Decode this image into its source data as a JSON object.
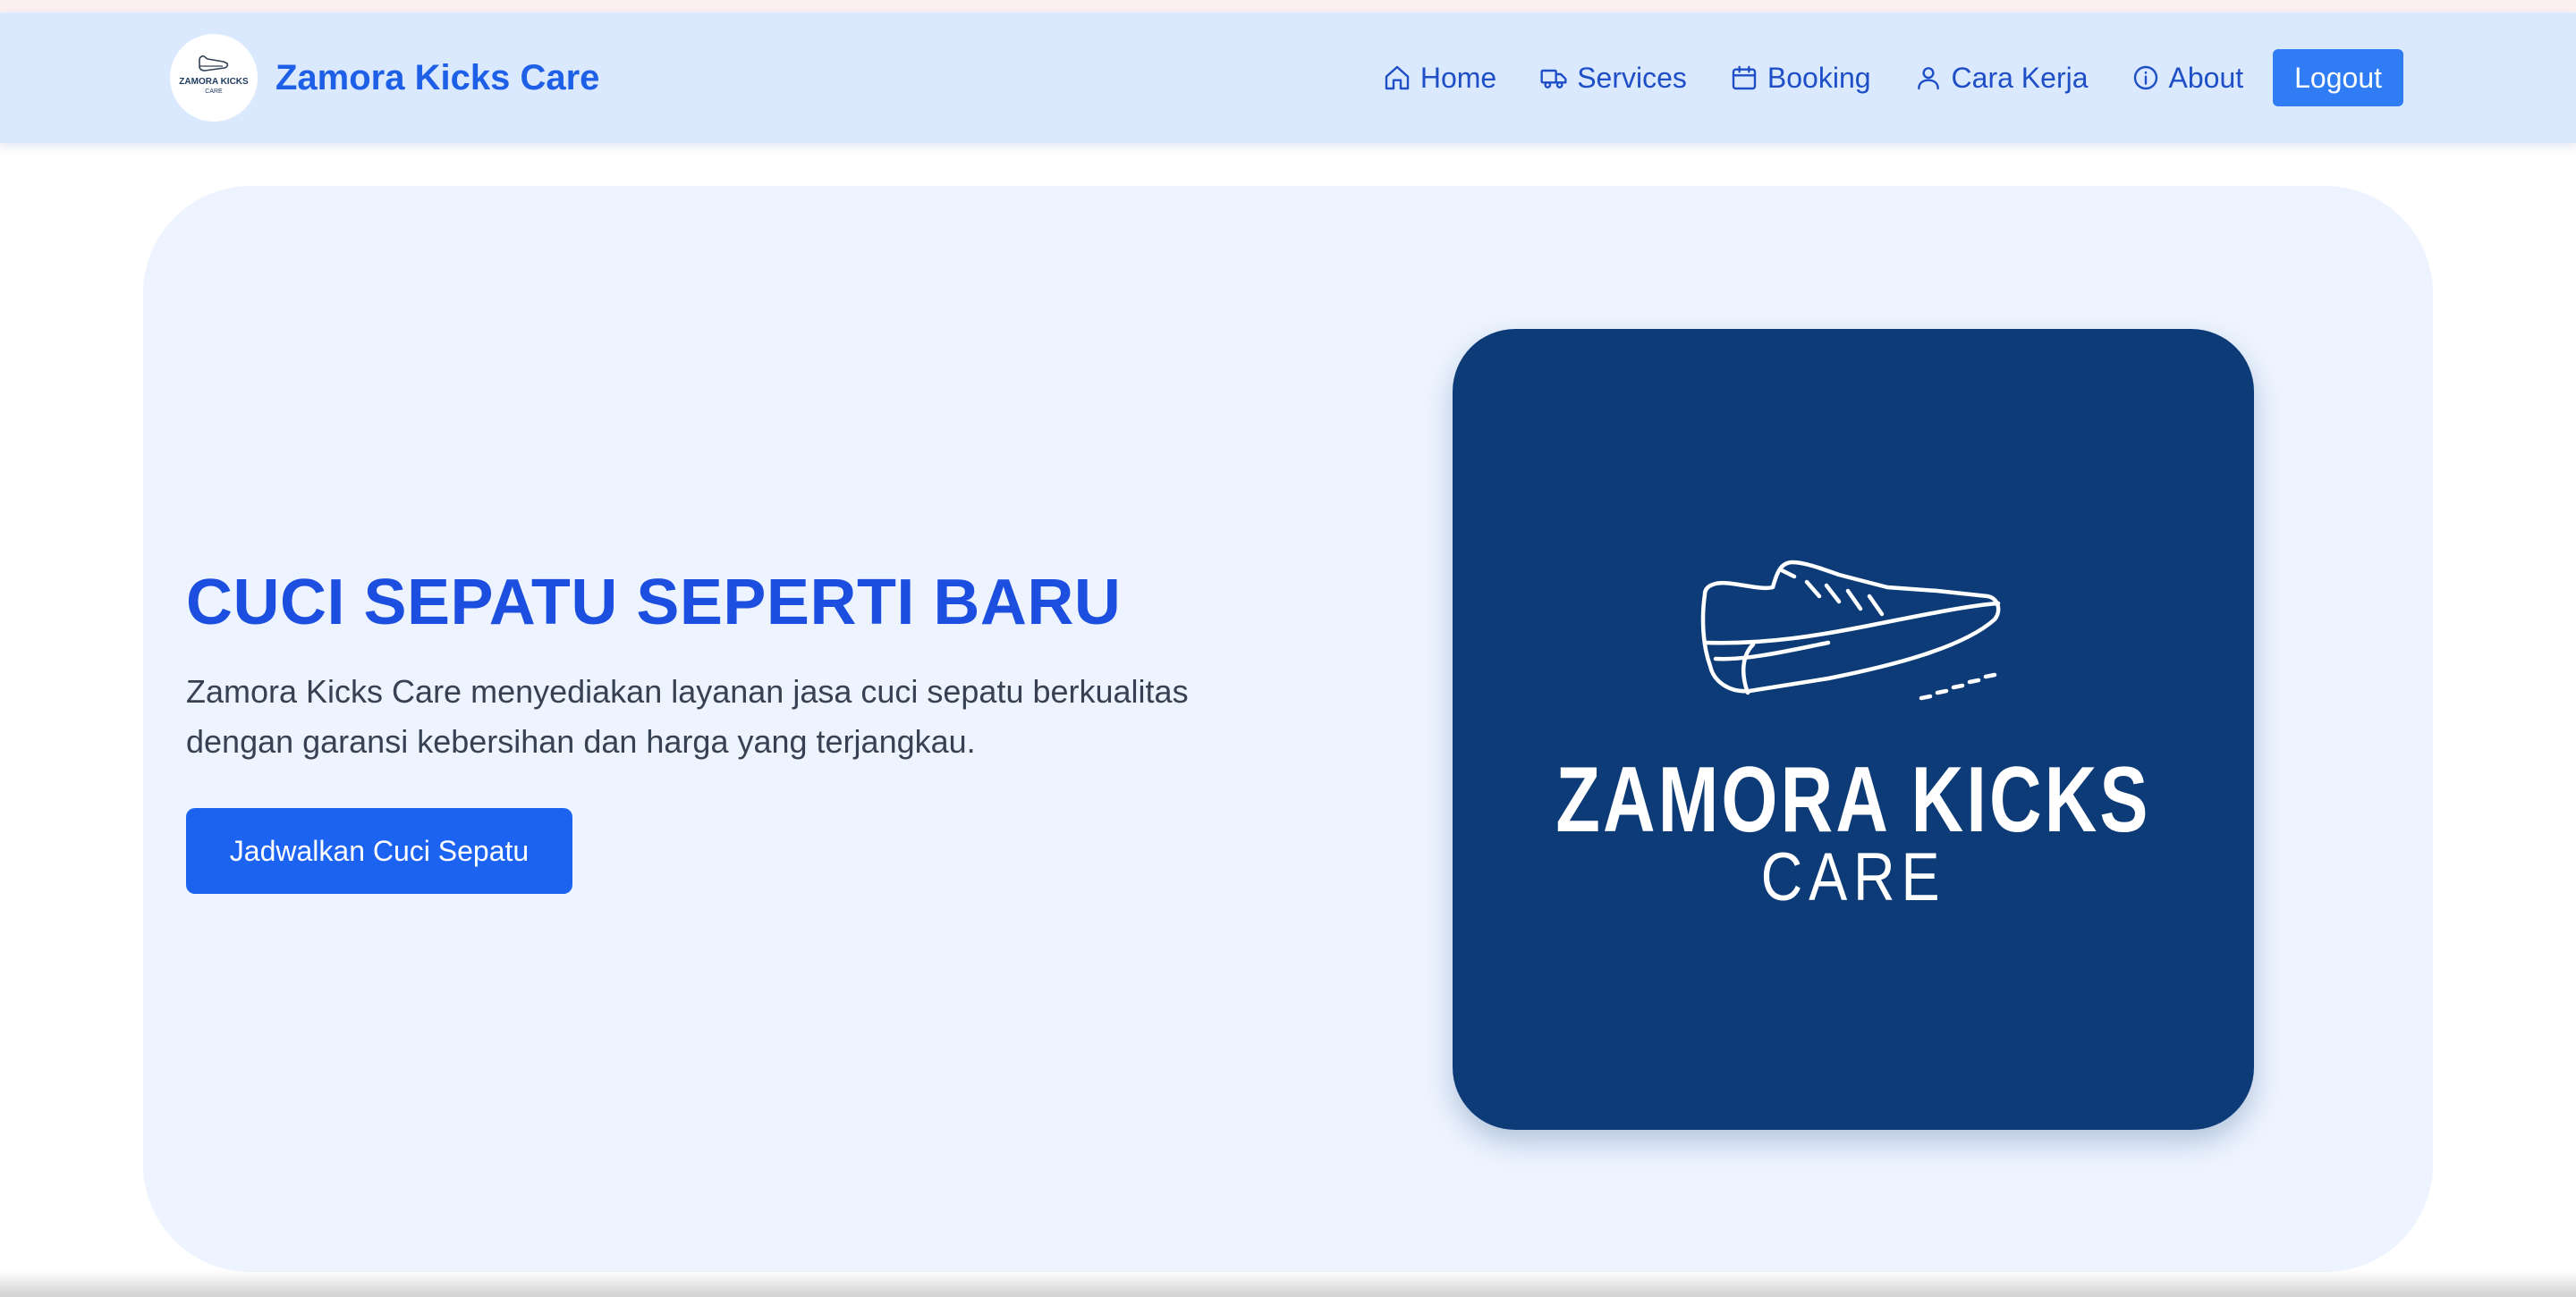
{
  "header": {
    "brand_name": "Zamora Kicks Care",
    "logo_text": "ZAMORA KICKS",
    "logo_subtext": "CARE",
    "nav": {
      "home": "Home",
      "services": "Services",
      "booking": "Booking",
      "cara_kerja": "Cara Kerja",
      "about": "About",
      "logout": "Logout"
    }
  },
  "hero": {
    "title": "CUCI SEPATU SEPERTI BARU",
    "description": "Zamora Kicks Care menyediakan layanan jasa cuci sepatu berkualitas dengan garansi kebersihan dan harga yang terjangkau.",
    "cta_label": "Jadwalkan Cuci Sepatu",
    "logo_title": "ZAMORA KICKS",
    "logo_subtitle": "CARE"
  },
  "icons": {
    "home": "home-icon",
    "services": "truck-icon",
    "booking": "calendar-icon",
    "cara_kerja": "user-icon",
    "about": "info-icon",
    "logo": "shoe-icon"
  },
  "colors": {
    "navbar_bg": "#dbe9fe",
    "brand_blue": "#1d5fe6",
    "title_blue": "#1c4fe0",
    "logout_bg": "#2f7cf5",
    "cta_bg": "#1d63f2",
    "hero_bg": "#edf4ff",
    "logo_card_bg": "#0c3b77"
  }
}
